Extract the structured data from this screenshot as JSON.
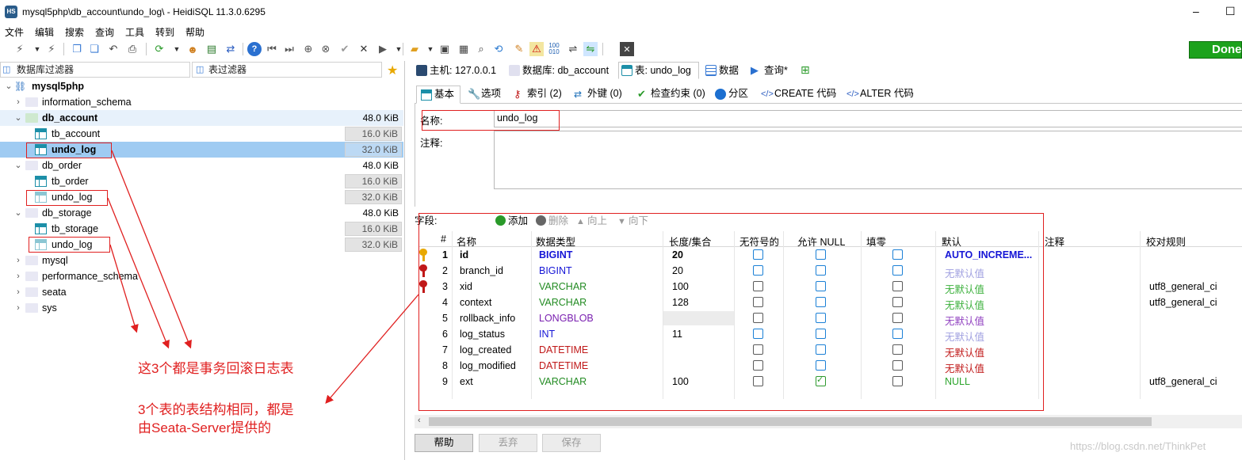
{
  "window": {
    "title": "mysql5php\\db_account\\undo_log\\ - HeidiSQL 11.3.0.6295",
    "app_icon_text": "HS",
    "minimize": "–",
    "maximize": "☐"
  },
  "menu": [
    "文件",
    "编辑",
    "搜索",
    "查询",
    "工具",
    "转到",
    "帮助"
  ],
  "toolbar": {
    "done_label": "Done"
  },
  "left": {
    "db_filter_placeholder": "数据库过滤器",
    "table_filter_placeholder": "表过滤器",
    "tree": [
      {
        "label": "mysql5php",
        "level": 0,
        "bold": true,
        "size": ""
      },
      {
        "label": "information_schema",
        "level": 1,
        "size": ""
      },
      {
        "label": "db_account",
        "level": 1,
        "bold": true,
        "size": "48.0 KiB"
      },
      {
        "label": "tb_account",
        "level": 2,
        "size": "16.0 KiB"
      },
      {
        "label": "undo_log",
        "level": 2,
        "bold": true,
        "size": "32.0 KiB"
      },
      {
        "label": "db_order",
        "level": 1,
        "size": "48.0 KiB"
      },
      {
        "label": "tb_order",
        "level": 2,
        "size": "16.0 KiB"
      },
      {
        "label": "undo_log",
        "level": 2,
        "size": "32.0 KiB"
      },
      {
        "label": "db_storage",
        "level": 1,
        "size": "48.0 KiB"
      },
      {
        "label": "tb_storage",
        "level": 2,
        "size": "16.0 KiB"
      },
      {
        "label": "undo_log",
        "level": 2,
        "size": "32.0 KiB"
      },
      {
        "label": "mysql",
        "level": 1,
        "size": ""
      },
      {
        "label": "performance_schema",
        "level": 1,
        "size": ""
      },
      {
        "label": "seata",
        "level": 1,
        "size": ""
      },
      {
        "label": "sys",
        "level": 1,
        "size": ""
      }
    ]
  },
  "annotations": {
    "note1": "这3个都是事务回滚日志表",
    "note2_line1": "3个表的表结构相同，都是",
    "note2_line2": "由Seata-Server提供的"
  },
  "tabs": [
    {
      "label": "主机: 127.0.0.1",
      "icon": "host-icon"
    },
    {
      "label": "数据库: db_account",
      "icon": "database-icon"
    },
    {
      "label": "表: undo_log",
      "icon": "table-icon",
      "active": true
    },
    {
      "label": "数据",
      "icon": "grid-icon"
    },
    {
      "label": "查询*",
      "icon": "play-icon"
    }
  ],
  "subtabs": [
    {
      "label": "基本",
      "active": true
    },
    {
      "label": "选项"
    },
    {
      "label": "索引 (2)"
    },
    {
      "label": "外键 (0)"
    },
    {
      "label": "检查约束 (0)"
    },
    {
      "label": "分区"
    },
    {
      "label": "CREATE 代码"
    },
    {
      "label": "ALTER 代码"
    }
  ],
  "basic": {
    "name_label": "名称:",
    "name_value": "undo_log",
    "comment_label": "注释:",
    "comment_value": ""
  },
  "fields": {
    "label": "字段:",
    "add": "添加",
    "delete": "删除",
    "up": "向上",
    "down": "向下"
  },
  "grid": {
    "headers": [
      "#",
      "名称",
      "数据类型",
      "长度/集合",
      "无符号的",
      "允许 NULL",
      "填零",
      "默认",
      "注释",
      "校对规则"
    ],
    "rows": [
      {
        "num": "1",
        "name": "id",
        "type": "BIGINT",
        "length": "20",
        "unsigned": true,
        "null": false,
        "zerofill": true,
        "default": "AUTO_INCREME...",
        "comment": "",
        "collation": "",
        "key": "primary",
        "bold": true
      },
      {
        "num": "2",
        "name": "branch_id",
        "type": "BIGINT",
        "length": "20",
        "unsigned": true,
        "null": false,
        "zerofill": true,
        "default": "无默认值",
        "comment": "",
        "collation": "",
        "key": "unique"
      },
      {
        "num": "3",
        "name": "xid",
        "type": "VARCHAR",
        "length": "100",
        "unsigned": false,
        "null": false,
        "zerofill": false,
        "default": "无默认值",
        "comment": "",
        "collation": "utf8_general_ci",
        "key": "unique"
      },
      {
        "num": "4",
        "name": "context",
        "type": "VARCHAR",
        "length": "128",
        "unsigned": false,
        "null": false,
        "zerofill": false,
        "default": "无默认值",
        "comment": "",
        "collation": "utf8_general_ci",
        "key": ""
      },
      {
        "num": "5",
        "name": "rollback_info",
        "type": "LONGBLOB",
        "length": "",
        "unsigned": false,
        "null": false,
        "zerofill": false,
        "default": "无默认值",
        "comment": "",
        "collation": "",
        "key": ""
      },
      {
        "num": "6",
        "name": "log_status",
        "type": "INT",
        "length": "11",
        "unsigned": true,
        "null": false,
        "zerofill": true,
        "default": "无默认值",
        "comment": "",
        "collation": "",
        "key": ""
      },
      {
        "num": "7",
        "name": "log_created",
        "type": "DATETIME",
        "length": "",
        "unsigned": false,
        "null": false,
        "zerofill": false,
        "default": "无默认值",
        "comment": "",
        "collation": "",
        "key": ""
      },
      {
        "num": "8",
        "name": "log_modified",
        "type": "DATETIME",
        "length": "",
        "unsigned": false,
        "null": false,
        "zerofill": false,
        "default": "无默认值",
        "comment": "",
        "collation": "",
        "key": ""
      },
      {
        "num": "9",
        "name": "ext",
        "type": "VARCHAR",
        "length": "100",
        "unsigned": false,
        "null": true,
        "zerofill": false,
        "default": "NULL",
        "comment": "",
        "collation": "utf8_general_ci",
        "key": ""
      }
    ]
  },
  "buttons": {
    "help": "帮助",
    "discard": "丢弃",
    "save": "保存"
  },
  "watermark": "https://blog.csdn.net/ThinkPet",
  "colors": {
    "accent_red": "#e02020",
    "int_type": "#1515d6",
    "string_type": "#228b22",
    "blob_type": "#7a20b0",
    "date_type": "#c01818",
    "selected_row": "#9fcbf2",
    "done_green": "#1ca21c"
  }
}
